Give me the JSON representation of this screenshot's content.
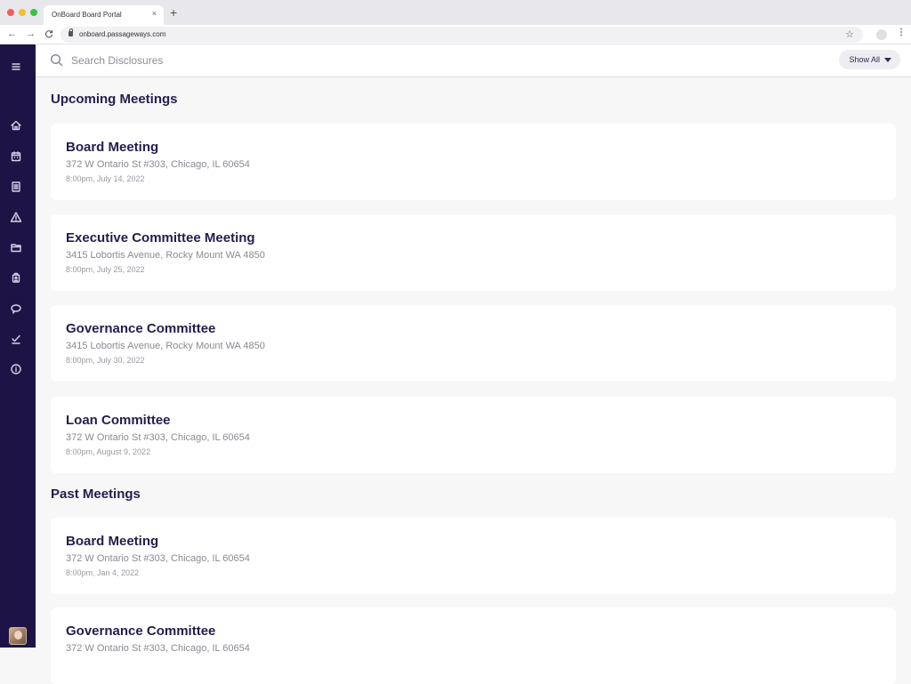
{
  "browser": {
    "tab_title": "OnBoard Board Portal",
    "tab_close": "×",
    "new_tab": "+",
    "url": "onboard.passageways.com",
    "back": "←",
    "forward": "→",
    "reload": "C",
    "star": "☆",
    "menu": "⋮"
  },
  "sidebar": {
    "items": [
      {
        "icon": "menu-icon"
      },
      {
        "icon": "home-icon"
      },
      {
        "icon": "calendar-icon"
      },
      {
        "icon": "document-icon"
      },
      {
        "icon": "warning-icon"
      },
      {
        "icon": "folder-icon"
      },
      {
        "icon": "badge-icon"
      },
      {
        "icon": "chat-icon"
      },
      {
        "icon": "checkmark-icon"
      },
      {
        "icon": "info-icon"
      }
    ]
  },
  "search": {
    "placeholder": "Search Disclosures",
    "value": "",
    "filter_label": "Show All"
  },
  "sections": {
    "upcoming": {
      "title": "Upcoming Meetings",
      "meetings": [
        {
          "title": "Board Meeting",
          "address": "372 W Ontario St #303, Chicago, IL 60654",
          "datetime": "8:00pm, July 14, 2022"
        },
        {
          "title": "Executive Committee Meeting",
          "address": "3415 Lobortis Avenue, Rocky Mount WA 4850",
          "datetime": "8:00pm, July 25, 2022"
        },
        {
          "title": "Governance Committee",
          "address": "3415 Lobortis Avenue, Rocky Mount WA 4850",
          "datetime": "8:00pm, July 30, 2022"
        },
        {
          "title": "Loan Committee",
          "address": "372 W Ontario St #303, Chicago, IL 60654",
          "datetime": "8:00pm, August 9, 2022"
        }
      ]
    },
    "past": {
      "title": "Past Meetings",
      "meetings": [
        {
          "title": "Board Meeting",
          "address": "372 W Ontario St #303, Chicago, IL 60654",
          "datetime": "8:00pm, Jan 4, 2022"
        },
        {
          "title": "Governance Committee",
          "address": "372 W Ontario St #303, Chicago, IL 60654",
          "datetime": ""
        }
      ]
    }
  }
}
